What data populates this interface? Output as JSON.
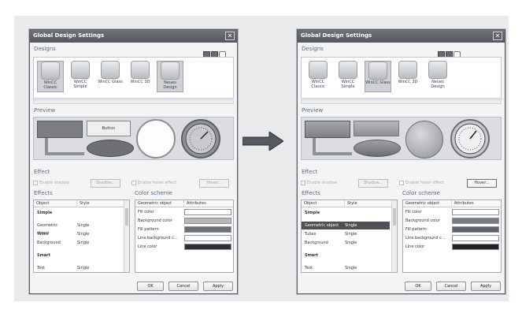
{
  "dialogs": [
    {
      "title": "Global Design Settings",
      "close_glyph": "✕",
      "designs_label": "Designs",
      "preview_label": "Preview",
      "effect_label": "Effect",
      "effects_label": "Effects",
      "color_scheme_label": "Color scheme",
      "preview_button_text": "Button",
      "designs": [
        {
          "label": "WinCC Classic",
          "selected": true
        },
        {
          "label": "WinCC Simple",
          "selected": false
        },
        {
          "label": "WinCC Glass",
          "selected": false
        },
        {
          "label": "WinCC 3D",
          "selected": false
        },
        {
          "label": "Neues Design",
          "selected": true
        }
      ],
      "controls": {
        "enable_shadow": "Enable shadow",
        "shadow_button": "Shadow...",
        "enable_hover": "Enable hover effect",
        "hover_button": "Hover..."
      },
      "effects_table": {
        "headers": [
          "Object",
          "Style"
        ],
        "rows": [
          {
            "object": "Simple",
            "style": "",
            "group": true
          },
          {
            "object": "Geometric object",
            "style": "Single",
            "group": false
          },
          {
            "object": "Tubes",
            "style": "Single",
            "group": false
          },
          {
            "object": "Background",
            "style": "Single",
            "group": false
          },
          {
            "object": "Smart",
            "style": "",
            "group": true
          },
          {
            "object": "Text object",
            "style": "Single",
            "group": false
          }
        ]
      },
      "color_table": {
        "headers": [
          "Geometric object",
          "Attributes"
        ],
        "rows": [
          {
            "label": "Fill color",
            "color": "#ffffff"
          },
          {
            "label": "Background color",
            "color": "#b4b6b9"
          },
          {
            "label": "Fill pattern",
            "color": "#6d7075"
          },
          {
            "label": "Line background c...",
            "color": "#ffffff"
          },
          {
            "label": "Line color",
            "color": "#2e3136"
          }
        ]
      },
      "buttons": {
        "ok": "OK",
        "cancel": "Cancel",
        "apply": "Apply"
      }
    },
    {
      "title": "Global Design Settings",
      "close_glyph": "✕",
      "designs_label": "Designs",
      "preview_label": "Preview",
      "effect_label": "Effect",
      "effects_label": "Effects",
      "color_scheme_label": "Color scheme",
      "designs": [
        {
          "label": "WinCC Classic",
          "selected": false
        },
        {
          "label": "WinCC Simple",
          "selected": false
        },
        {
          "label": "WinCC Glass",
          "selected": true
        },
        {
          "label": "WinCC 3D",
          "selected": false
        },
        {
          "label": "Neues Design",
          "selected": false
        }
      ],
      "controls": {
        "enable_shadow": "Enable shadow",
        "shadow_button": "Shadow...",
        "enable_hover": "Enable hover effect",
        "hover_button": "Hover..."
      },
      "effects_table": {
        "headers": [
          "Object",
          "Style"
        ],
        "rows": [
          {
            "object": "Simple",
            "style": "",
            "group": true
          },
          {
            "object": "Geometric object",
            "style": "Single",
            "group": false,
            "highlight": true
          },
          {
            "object": "Tubes",
            "style": "Single",
            "group": false
          },
          {
            "object": "Background",
            "style": "Single",
            "group": false
          },
          {
            "object": "Smart",
            "style": "",
            "group": true
          },
          {
            "object": "Text object",
            "style": "Single",
            "group": false
          }
        ]
      },
      "color_table": {
        "headers": [
          "Geometric object",
          "Attributes"
        ],
        "rows": [
          {
            "label": "Fill color",
            "color": "#ffffff"
          },
          {
            "label": "Background color",
            "color": "#777a80"
          },
          {
            "label": "Fill pattern",
            "color": "#5f6268"
          },
          {
            "label": "Line background c...",
            "color": "#ffffff"
          },
          {
            "label": "Line color",
            "color": "#1f2227"
          }
        ]
      },
      "buttons": {
        "ok": "OK",
        "cancel": "Cancel",
        "apply": "Apply"
      }
    }
  ],
  "colors": {
    "arrow": "#555a60",
    "selection": "#4d5156"
  }
}
